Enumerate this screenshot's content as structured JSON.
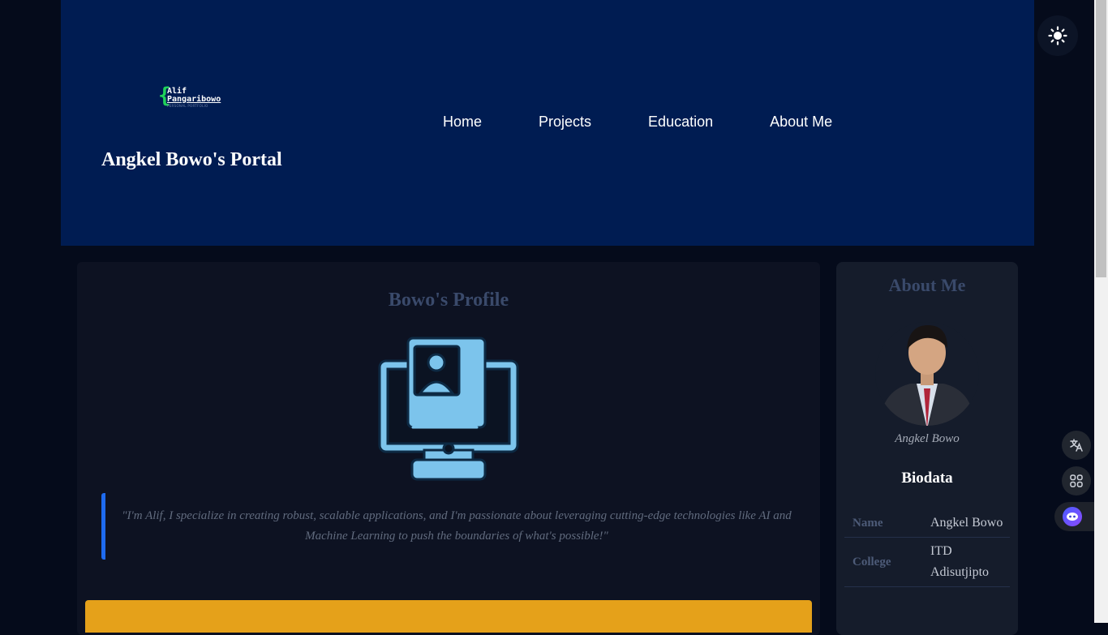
{
  "header": {
    "logo": {
      "line1": "Alif",
      "line2": "Pangaribowo",
      "line3": "PERSONAL PORTFOLIO"
    },
    "site_title": "Angkel Bowo's Portal",
    "nav": [
      "Home",
      "Projects",
      "Education",
      "About Me"
    ]
  },
  "theme_toggle": {
    "icon": "sun-icon"
  },
  "profile": {
    "title": "Bowo's Profile",
    "illustration_icon": "profile-computer-icon",
    "quote": "\"I'm Alif, I specialize in creating robust, scalable applications, and I'm passionate about leveraging cutting-edge technologies like AI and Machine Learning to push the boundaries of what's possible!\""
  },
  "about": {
    "title": "About Me",
    "avatar_caption": "Angkel Bowo",
    "biodata_heading": "Biodata",
    "rows": [
      {
        "key": "Name",
        "value": "Angkel Bowo"
      },
      {
        "key": "College",
        "value": "ITD Adisutjipto"
      }
    ]
  },
  "floating": {
    "translate_icon": "translate-icon",
    "apps_icon": "apps-icon",
    "assistant_icon": "assistant-icon"
  },
  "colors": {
    "header_bg": "#001c52",
    "page_bg": "#050b1b",
    "accent_blue": "#1e6bf0",
    "cta_yellow": "#e5a11a"
  }
}
